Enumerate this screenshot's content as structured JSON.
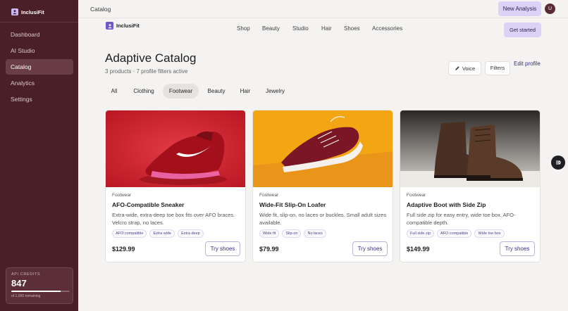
{
  "sidebar": {
    "brand": "InclusiFit",
    "items": [
      {
        "label": "Dashboard"
      },
      {
        "label": "AI Studio"
      },
      {
        "label": "Catalog"
      },
      {
        "label": "Analytics"
      },
      {
        "label": "Settings"
      }
    ],
    "active": "Catalog",
    "credits": {
      "label": "API CREDITS",
      "value": "847",
      "sub": "of 1,000 remaining",
      "fraction": 0.847
    }
  },
  "header": {
    "title": "Catalog",
    "new_analysis": "New Analysis",
    "avatar": "U"
  },
  "app": {
    "brand": "InclusiFit",
    "nav": [
      "Shop",
      "Beauty",
      "Studio",
      "Hair",
      "Shoes",
      "Accessories"
    ],
    "get_started": "Get started"
  },
  "page": {
    "title": "Adaptive Catalog",
    "subtitle": "3 products · 7 profile filters active",
    "voice": "Voice",
    "filters": "Filters",
    "edit_profile": "Edit profile"
  },
  "tabs": [
    "All",
    "Clothing",
    "Footwear",
    "Beauty",
    "Hair",
    "Jewelry"
  ],
  "active_tab": "Footwear",
  "products": [
    {
      "category": "Footwear",
      "name": "AFO-Compatible Sneaker",
      "description": "Extra-wide, extra-deep toe box fits over AFO braces. Velcro strap, no laces.",
      "tags": [
        "AFO compatible",
        "Extra wide",
        "Extra deep"
      ],
      "price": "$129.99",
      "cta": "Try shoes"
    },
    {
      "category": "Footwear",
      "name": "Wide-Fit Slip-On Loafer",
      "description": "Wide fit, slip-on, no laces or buckles. Small adult sizes available.",
      "tags": [
        "Wide fit",
        "Slip-on",
        "No laces"
      ],
      "price": "$79.99",
      "cta": "Try shoes"
    },
    {
      "category": "Footwear",
      "name": "Adaptive Boot with Side Zip",
      "description": "Full side zip for easy entry, wide toe box, AFO-compatible depth.",
      "tags": [
        "Full side zip",
        "AFO compatible",
        "Wide toe box"
      ],
      "price": "$149.99",
      "cta": "Try shoes"
    }
  ],
  "colors": {
    "sidebar_bg": "#4a1f27",
    "accent": "#dcd2f5",
    "accent_text": "#3b2e80"
  }
}
